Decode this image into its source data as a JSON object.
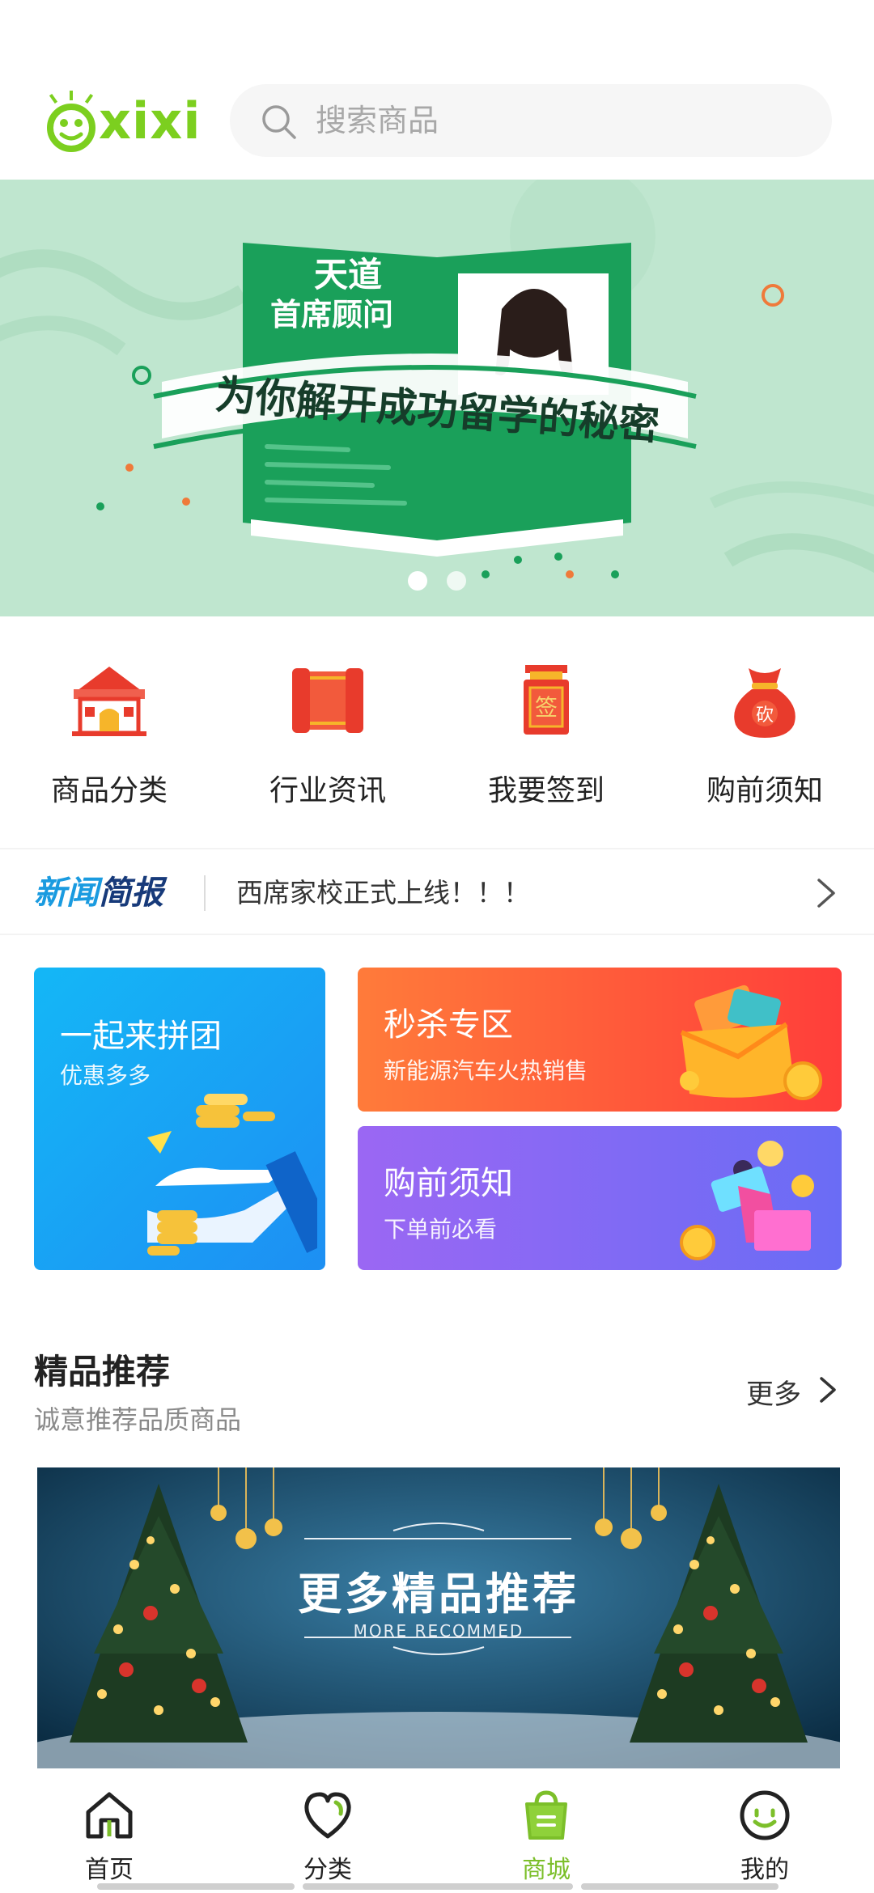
{
  "colors": {
    "brand": "#7cbf2a",
    "banner_bg": "#bfe6cf",
    "book_green": "#1aa05a",
    "tuan_blue": "#1d8ff3",
    "miao_red": "#ff3e3a",
    "xuzhi_purple": "#7b6af4"
  },
  "header": {
    "logo_text": "xixi",
    "search_placeholder": "搜索商品",
    "search_icon": "search-icon"
  },
  "banner": {
    "book_title": "天道",
    "book_subtitle": "首席顾问",
    "ribbon_text": "为你解开成功留学的秘密",
    "slide_count": 2,
    "active_slide": 1
  },
  "quick_menu": [
    {
      "label": "商品分类",
      "icon": "shop-house-icon"
    },
    {
      "label": "行业资讯",
      "icon": "scroll-icon"
    },
    {
      "label": "我要签到",
      "icon": "sign-lantern-icon"
    },
    {
      "label": "购前须知",
      "icon": "money-bag-icon"
    }
  ],
  "news": {
    "brand_part1": "新闻",
    "brand_part2": "简报",
    "headline": "西席家校正式上线！！！"
  },
  "promos": {
    "tuan": {
      "title": "一起来拼团",
      "subtitle": "优惠多多"
    },
    "miaosha": {
      "title": "秒杀专区",
      "subtitle": "新能源汽车火热销售"
    },
    "xuzhi": {
      "title": "购前须知",
      "subtitle": "下单前必看"
    }
  },
  "featured": {
    "title": "精品推荐",
    "subtitle": "诚意推荐品质商品",
    "more_label": "更多",
    "banner_title": "更多精品推荐",
    "banner_subtitle": "MORE   RECOMMED"
  },
  "tabbar": [
    {
      "label": "首页",
      "icon": "home-icon",
      "active": false
    },
    {
      "label": "分类",
      "icon": "heart-icon",
      "active": false
    },
    {
      "label": "商城",
      "icon": "shopping-bag-icon",
      "active": true
    },
    {
      "label": "我的",
      "icon": "smile-icon",
      "active": false
    }
  ]
}
